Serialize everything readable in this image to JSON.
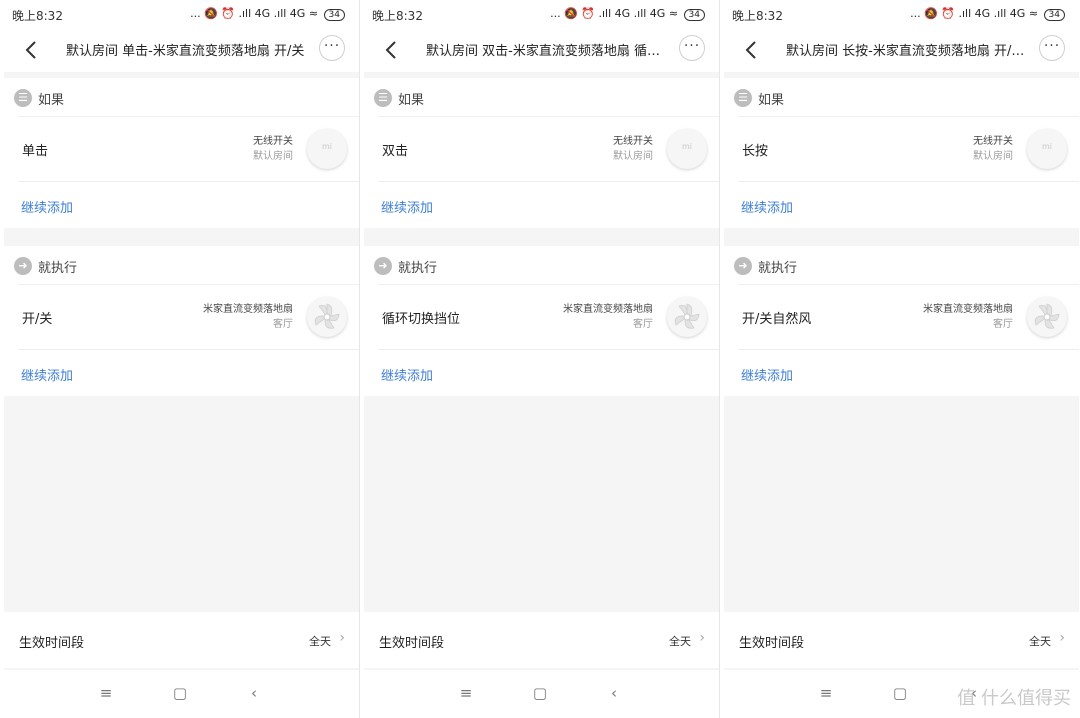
{
  "status_bar": {
    "time": "晚上8:32",
    "icons": "... 🔕 ⏰ .ıll 4G .ıll 4G ≈",
    "battery": "34"
  },
  "panels": [
    {
      "title": "默认房间 单击-米家直流变频落地扇 开/关",
      "if_label": "如果",
      "trigger": {
        "label": "单击",
        "device_name": "无线开关",
        "device_room": "默认房间",
        "thumb": "mi"
      },
      "if_add": "继续添加",
      "then_label": "就执行",
      "action": {
        "label": "开/关",
        "device_name": "米家直流变频落地扇",
        "device_room": "客厅"
      },
      "then_add": "继续添加",
      "time_label": "生效时间段",
      "time_value": "全天"
    },
    {
      "title": "默认房间 双击-米家直流变频落地扇 循环切...",
      "if_label": "如果",
      "trigger": {
        "label": "双击",
        "device_name": "无线开关",
        "device_room": "默认房间",
        "thumb": "mi"
      },
      "if_add": "继续添加",
      "then_label": "就执行",
      "action": {
        "label": "循环切换挡位",
        "device_name": "米家直流变频落地扇",
        "device_room": "客厅"
      },
      "then_add": "继续添加",
      "time_label": "生效时间段",
      "time_value": "全天"
    },
    {
      "title": "默认房间 长按-米家直流变频落地扇 开/关...",
      "if_label": "如果",
      "trigger": {
        "label": "长按",
        "device_name": "无线开关",
        "device_room": "默认房间",
        "thumb": "mi"
      },
      "if_add": "继续添加",
      "then_label": "就执行",
      "action": {
        "label": "开/关自然风",
        "device_name": "米家直流变频落地扇",
        "device_room": "客厅"
      },
      "then_add": "继续添加",
      "time_label": "生效时间段",
      "time_value": "全天"
    }
  ],
  "watermark": "值 什么值得买",
  "colors": {
    "accent": "#3f7fd6",
    "band": "#f5f5f5",
    "icon_bg": "#bdbdbd"
  },
  "icons": {
    "back": "chevron-left-icon",
    "more": "more-dots-icon",
    "if": "list-icon",
    "then": "arrow-right-icon",
    "time": "chevron-right-icon"
  }
}
